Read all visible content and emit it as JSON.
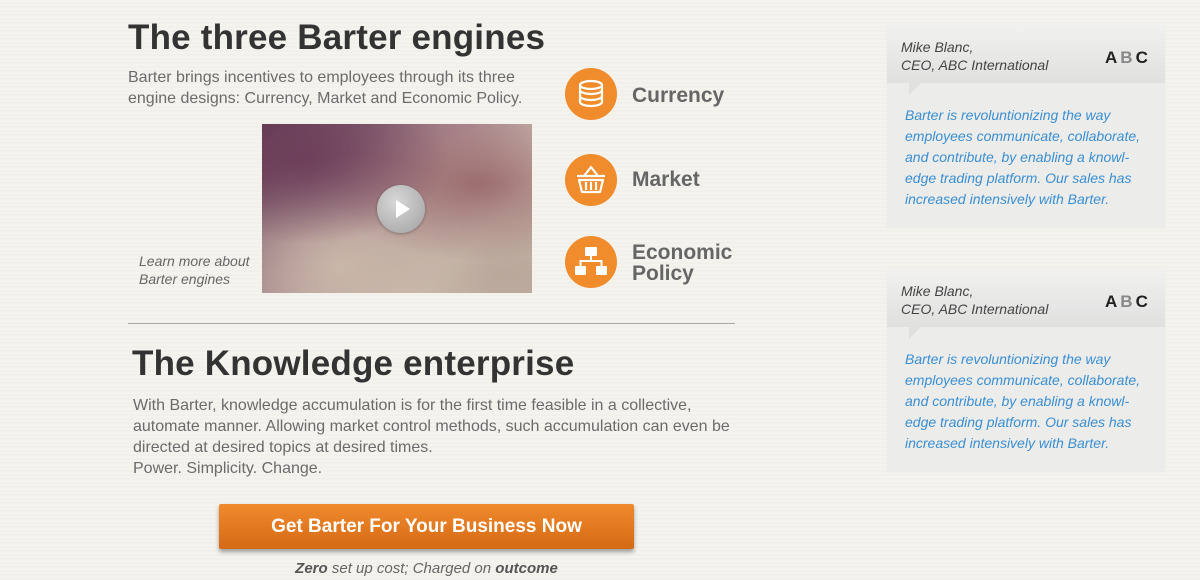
{
  "engines_section": {
    "title": "The three Barter engines",
    "description": "Barter brings incentives to employees through its three engine designs: Currency, Market and Economic Policy.",
    "video_caption": "Learn more about Barter engines",
    "engines": [
      {
        "label": "Currency",
        "icon": "coins-icon"
      },
      {
        "label": "Market",
        "icon": "basket-icon"
      },
      {
        "label": "Economic Policy",
        "icon": "org-chart-icon"
      }
    ]
  },
  "knowledge_section": {
    "title": "The Knowledge enterprise",
    "paragraph": "With Barter, knowledge accumulation is for the first time feasible in a collective, automate manner. Allowing market control methods, such accumulation can even be directed at desired topics at desired times.",
    "tagline": "Power. Simplicity. Change."
  },
  "cta": {
    "button_label": "Get Barter For Your Business Now",
    "note_zero": "Zero",
    "note_middle": " set up cost; Charged on ",
    "note_outcome": "outcome"
  },
  "testimonials": [
    {
      "name": "Mike Blanc,",
      "role": "CEO, ABC International",
      "logo": [
        "A",
        "B",
        "C"
      ],
      "quote": "Barter is revoluntionizing the way employees communicate, collaborate, and contribute, by enabling a knowl-edge trading platform. Our sales has increased intensively with Barter."
    },
    {
      "name": "Mike Blanc,",
      "role": "CEO, ABC International",
      "logo": [
        "A",
        "B",
        "C"
      ],
      "quote": "Barter is revoluntionizing the way employees communicate, collaborate, and contribute, by enabling a knowl-edge trading platform. Our sales has increased intensively with Barter."
    }
  ],
  "colors": {
    "accent_orange": "#f08c2b",
    "quote_blue": "#3a8fd2",
    "background": "#f5f3ee"
  }
}
